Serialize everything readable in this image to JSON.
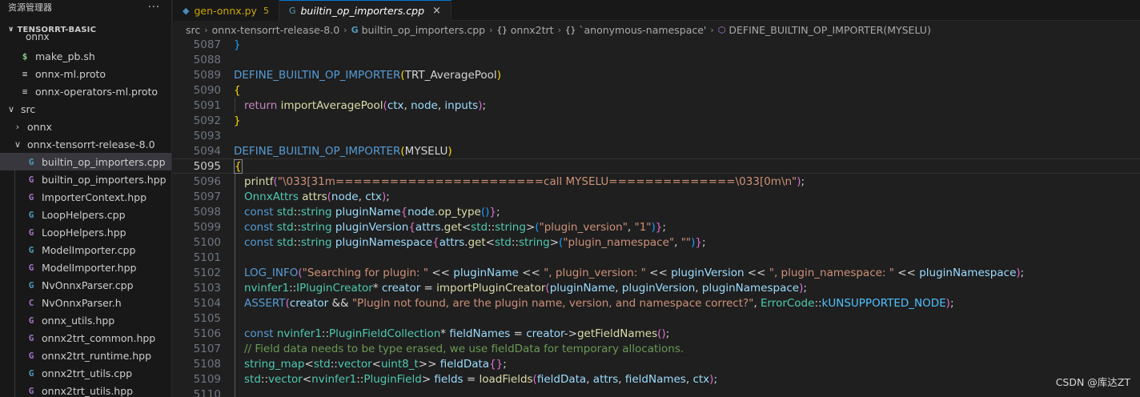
{
  "sidebar": {
    "title": "资源管理器",
    "more_label": "···",
    "section": "TENSORRT-BASIC",
    "cut_row": "onnx",
    "items": [
      {
        "name": "make_pb.sh",
        "icon": "shell-icon",
        "glyph": "$",
        "type": "shell",
        "depth": 1
      },
      {
        "name": "onnx-ml.proto",
        "icon": "lines-icon",
        "glyph": "≡",
        "type": "lines",
        "depth": 1
      },
      {
        "name": "onnx-operators-ml.proto",
        "icon": "lines-icon",
        "glyph": "≡",
        "type": "lines",
        "depth": 1
      },
      {
        "name": "src",
        "icon": "chevron-down-icon",
        "glyph": "∨",
        "type": "folder",
        "depth": 0
      },
      {
        "name": "onnx",
        "icon": "chevron-right-icon",
        "glyph": "›",
        "type": "folder",
        "depth": 1
      },
      {
        "name": "onnx-tensorrt-release-8.0",
        "icon": "chevron-down-icon",
        "glyph": "∨",
        "type": "folder",
        "depth": 1
      },
      {
        "name": "builtin_op_importers.cpp",
        "icon": "cpp-file-icon",
        "glyph": "G",
        "type": "cpp",
        "depth": 2,
        "selected": true
      },
      {
        "name": "builtin_op_importers.hpp",
        "icon": "hpp-file-icon",
        "glyph": "G",
        "type": "hpp",
        "depth": 2
      },
      {
        "name": "ImporterContext.hpp",
        "icon": "hpp-file-icon",
        "glyph": "G",
        "type": "hpp",
        "depth": 2
      },
      {
        "name": "LoopHelpers.cpp",
        "icon": "cpp-file-icon",
        "glyph": "G",
        "type": "cpp",
        "depth": 2
      },
      {
        "name": "LoopHelpers.hpp",
        "icon": "hpp-file-icon",
        "glyph": "G",
        "type": "hpp",
        "depth": 2
      },
      {
        "name": "ModelImporter.cpp",
        "icon": "cpp-file-icon",
        "glyph": "G",
        "type": "cpp",
        "depth": 2
      },
      {
        "name": "ModelImporter.hpp",
        "icon": "hpp-file-icon",
        "glyph": "G",
        "type": "hpp",
        "depth": 2
      },
      {
        "name": "NvOnnxParser.cpp",
        "icon": "cpp-file-icon",
        "glyph": "G",
        "type": "cpp",
        "depth": 2
      },
      {
        "name": "NvOnnxParser.h",
        "icon": "h-file-icon",
        "glyph": "C",
        "type": "h",
        "depth": 2
      },
      {
        "name": "onnx_utils.hpp",
        "icon": "hpp-file-icon",
        "glyph": "G",
        "type": "hpp",
        "depth": 2
      },
      {
        "name": "onnx2trt_common.hpp",
        "icon": "hpp-file-icon",
        "glyph": "G",
        "type": "hpp",
        "depth": 2
      },
      {
        "name": "onnx2trt_runtime.hpp",
        "icon": "hpp-file-icon",
        "glyph": "G",
        "type": "hpp",
        "depth": 2
      },
      {
        "name": "onnx2trt_utils.cpp",
        "icon": "cpp-file-icon",
        "glyph": "G",
        "type": "cpp",
        "depth": 2
      },
      {
        "name": "onnx2trt_utils.hpp",
        "icon": "hpp-file-icon",
        "glyph": "G",
        "type": "hpp",
        "depth": 2
      }
    ]
  },
  "tabs": [
    {
      "label": "gen-onnx.py",
      "badge": "5",
      "active": false,
      "icon_glyph": "◆"
    },
    {
      "label": "builtin_op_importers.cpp",
      "active": true,
      "icon_glyph": "G",
      "close": "×"
    }
  ],
  "breadcrumb": {
    "parts": [
      "src",
      "onnx-tensorrt-release-8.0",
      "builtin_op_importers.cpp",
      "onnx2trt",
      "`anonymous-namespace'",
      "DEFINE_BUILTIN_OP_IMPORTER(MYSELU)"
    ],
    "ns_glyph": "{}",
    "sep": "›"
  },
  "editor": {
    "lines": [
      {
        "n": "5087",
        "tokens": [
          [
            "k-brace3",
            "}"
          ]
        ]
      },
      {
        "n": "5088",
        "tokens": []
      },
      {
        "n": "5089",
        "tokens": [
          [
            "k-macro",
            "DEFINE_BUILTIN_OP_IMPORTER"
          ],
          [
            "k-brace1",
            "("
          ],
          [
            "k-plain",
            "TRT_AveragePool"
          ],
          [
            "k-brace1",
            ")"
          ]
        ]
      },
      {
        "n": "5090",
        "tokens": [
          [
            "k-brace1",
            "{"
          ]
        ]
      },
      {
        "n": "5091",
        "indent": 1,
        "tokens": [
          [
            "k-ctrl",
            "return "
          ],
          [
            "k-fn",
            "importAveragePool"
          ],
          [
            "k-brace2",
            "("
          ],
          [
            "k-var",
            "ctx"
          ],
          [
            "k-plain",
            ", "
          ],
          [
            "k-var",
            "node"
          ],
          [
            "k-plain",
            ", "
          ],
          [
            "k-var",
            "inputs"
          ],
          [
            "k-brace2",
            ")"
          ],
          [
            "k-plain",
            ";"
          ]
        ]
      },
      {
        "n": "5092",
        "tokens": [
          [
            "k-brace1",
            "}"
          ]
        ]
      },
      {
        "n": "5093",
        "tokens": []
      },
      {
        "n": "5094",
        "tokens": [
          [
            "k-macro",
            "DEFINE_BUILTIN_OP_IMPORTER"
          ],
          [
            "k-brace1",
            "("
          ],
          [
            "k-plain",
            "MYSELU"
          ],
          [
            "k-brace1",
            ")"
          ]
        ]
      },
      {
        "n": "5095",
        "current": true,
        "tokens": [
          [
            "k-brace1",
            "{"
          ]
        ]
      },
      {
        "n": "5096",
        "indent": 1,
        "tokens": [
          [
            "k-fn",
            "printf"
          ],
          [
            "k-brace2",
            "("
          ],
          [
            "k-str",
            "\"\\033[31m=======================call MYSELU==============\\033[0m\\n\""
          ],
          [
            "k-brace2",
            ")"
          ],
          [
            "k-plain",
            ";"
          ]
        ]
      },
      {
        "n": "5097",
        "indent": 1,
        "tokens": [
          [
            "k-type",
            "OnnxAttrs "
          ],
          [
            "k-fn",
            "attrs"
          ],
          [
            "k-brace2",
            "("
          ],
          [
            "k-var",
            "node"
          ],
          [
            "k-plain",
            ", "
          ],
          [
            "k-var",
            "ctx"
          ],
          [
            "k-brace2",
            ")"
          ],
          [
            "k-plain",
            ";"
          ]
        ]
      },
      {
        "n": "5098",
        "indent": 1,
        "tokens": [
          [
            "k-kw",
            "const "
          ],
          [
            "k-ns",
            "std"
          ],
          [
            "k-plain",
            "::"
          ],
          [
            "k-type",
            "string "
          ],
          [
            "k-var",
            "pluginName"
          ],
          [
            "k-brace2",
            "{"
          ],
          [
            "k-var",
            "node"
          ],
          [
            "k-plain",
            "."
          ],
          [
            "k-fn",
            "op_type"
          ],
          [
            "k-brace3",
            "()"
          ],
          [
            "k-brace2",
            "}"
          ],
          [
            "k-plain",
            ";"
          ]
        ]
      },
      {
        "n": "5099",
        "indent": 1,
        "tokens": [
          [
            "k-kw",
            "const "
          ],
          [
            "k-ns",
            "std"
          ],
          [
            "k-plain",
            "::"
          ],
          [
            "k-type",
            "string "
          ],
          [
            "k-var",
            "pluginVersion"
          ],
          [
            "k-brace2",
            "{"
          ],
          [
            "k-var",
            "attrs"
          ],
          [
            "k-plain",
            "."
          ],
          [
            "k-fn",
            "get"
          ],
          [
            "k-plain",
            "<"
          ],
          [
            "k-ns",
            "std"
          ],
          [
            "k-plain",
            "::"
          ],
          [
            "k-type",
            "string"
          ],
          [
            "k-plain",
            ">"
          ],
          [
            "k-brace3",
            "("
          ],
          [
            "k-str",
            "\"plugin_version\""
          ],
          [
            "k-plain",
            ", "
          ],
          [
            "k-str",
            "\"1\""
          ],
          [
            "k-brace3",
            ")"
          ],
          [
            "k-brace2",
            "}"
          ],
          [
            "k-plain",
            ";"
          ]
        ]
      },
      {
        "n": "5100",
        "indent": 1,
        "tokens": [
          [
            "k-kw",
            "const "
          ],
          [
            "k-ns",
            "std"
          ],
          [
            "k-plain",
            "::"
          ],
          [
            "k-type",
            "string "
          ],
          [
            "k-var",
            "pluginNamespace"
          ],
          [
            "k-brace2",
            "{"
          ],
          [
            "k-var",
            "attrs"
          ],
          [
            "k-plain",
            "."
          ],
          [
            "k-fn",
            "get"
          ],
          [
            "k-plain",
            "<"
          ],
          [
            "k-ns",
            "std"
          ],
          [
            "k-plain",
            "::"
          ],
          [
            "k-type",
            "string"
          ],
          [
            "k-plain",
            ">"
          ],
          [
            "k-brace3",
            "("
          ],
          [
            "k-str",
            "\"plugin_namespace\""
          ],
          [
            "k-plain",
            ", "
          ],
          [
            "k-str",
            "\"\""
          ],
          [
            "k-brace3",
            ")"
          ],
          [
            "k-brace2",
            "}"
          ],
          [
            "k-plain",
            ";"
          ]
        ]
      },
      {
        "n": "5101",
        "tokens": []
      },
      {
        "n": "5102",
        "indent": 1,
        "tokens": [
          [
            "k-macro",
            "LOG_INFO"
          ],
          [
            "k-brace2",
            "("
          ],
          [
            "k-str",
            "\"Searching for plugin: \""
          ],
          [
            "k-plain",
            " << "
          ],
          [
            "k-var",
            "pluginName"
          ],
          [
            "k-plain",
            " << "
          ],
          [
            "k-str",
            "\", plugin_version: \""
          ],
          [
            "k-plain",
            " << "
          ],
          [
            "k-var",
            "pluginVersion"
          ],
          [
            "k-plain",
            " << "
          ],
          [
            "k-str",
            "\", plugin_namespace: \""
          ],
          [
            "k-plain",
            " << "
          ],
          [
            "k-var",
            "pluginNamespace"
          ],
          [
            "k-brace2",
            ")"
          ],
          [
            "k-plain",
            ";"
          ]
        ]
      },
      {
        "n": "5103",
        "indent": 1,
        "tokens": [
          [
            "k-ns",
            "nvinfer1"
          ],
          [
            "k-plain",
            "::"
          ],
          [
            "k-type",
            "IPluginCreator"
          ],
          [
            "k-plain",
            "* "
          ],
          [
            "k-var",
            "creator"
          ],
          [
            "k-plain",
            " = "
          ],
          [
            "k-fn",
            "importPluginCreator"
          ],
          [
            "k-brace2",
            "("
          ],
          [
            "k-var",
            "pluginName"
          ],
          [
            "k-plain",
            ", "
          ],
          [
            "k-var",
            "pluginVersion"
          ],
          [
            "k-plain",
            ", "
          ],
          [
            "k-var",
            "pluginNamespace"
          ],
          [
            "k-brace2",
            ")"
          ],
          [
            "k-plain",
            ";"
          ]
        ]
      },
      {
        "n": "5104",
        "indent": 1,
        "tokens": [
          [
            "k-macro",
            "ASSERT"
          ],
          [
            "k-brace2",
            "("
          ],
          [
            "k-var",
            "creator"
          ],
          [
            "k-plain",
            " && "
          ],
          [
            "k-str",
            "\"Plugin not found, are the plugin name, version, and namespace correct?\""
          ],
          [
            "k-plain",
            ", "
          ],
          [
            "k-type",
            "ErrorCode"
          ],
          [
            "k-plain",
            "::"
          ],
          [
            "k-enum",
            "kUNSUPPORTED_NODE"
          ],
          [
            "k-brace2",
            ")"
          ],
          [
            "k-plain",
            ";"
          ]
        ]
      },
      {
        "n": "5105",
        "tokens": []
      },
      {
        "n": "5106",
        "indent": 1,
        "tokens": [
          [
            "k-kw",
            "const "
          ],
          [
            "k-ns",
            "nvinfer1"
          ],
          [
            "k-plain",
            "::"
          ],
          [
            "k-type",
            "PluginFieldCollection"
          ],
          [
            "k-plain",
            "* "
          ],
          [
            "k-var",
            "fieldNames"
          ],
          [
            "k-plain",
            " = "
          ],
          [
            "k-var",
            "creator"
          ],
          [
            "k-plain",
            "->"
          ],
          [
            "k-fn",
            "getFieldNames"
          ],
          [
            "k-brace2",
            "()"
          ],
          [
            "k-plain",
            ";"
          ]
        ]
      },
      {
        "n": "5107",
        "indent": 1,
        "tokens": [
          [
            "k-com",
            "// Field data needs to be type erased, we use fieldData for temporary allocations."
          ]
        ]
      },
      {
        "n": "5108",
        "indent": 1,
        "tokens": [
          [
            "k-type",
            "string_map"
          ],
          [
            "k-plain",
            "<"
          ],
          [
            "k-ns",
            "std"
          ],
          [
            "k-plain",
            "::"
          ],
          [
            "k-type",
            "vector"
          ],
          [
            "k-plain",
            "<"
          ],
          [
            "k-type",
            "uint8_t"
          ],
          [
            "k-plain",
            ">> "
          ],
          [
            "k-var",
            "fieldData"
          ],
          [
            "k-brace2",
            "{}"
          ],
          [
            "k-plain",
            ";"
          ]
        ]
      },
      {
        "n": "5109",
        "indent": 1,
        "tokens": [
          [
            "k-ns",
            "std"
          ],
          [
            "k-plain",
            "::"
          ],
          [
            "k-type",
            "vector"
          ],
          [
            "k-plain",
            "<"
          ],
          [
            "k-ns",
            "nvinfer1"
          ],
          [
            "k-plain",
            "::"
          ],
          [
            "k-type",
            "PluginField"
          ],
          [
            "k-plain",
            "> "
          ],
          [
            "k-var",
            "fields"
          ],
          [
            "k-plain",
            " = "
          ],
          [
            "k-fn",
            "loadFields"
          ],
          [
            "k-brace2",
            "("
          ],
          [
            "k-var",
            "fieldData"
          ],
          [
            "k-plain",
            ", "
          ],
          [
            "k-var",
            "attrs"
          ],
          [
            "k-plain",
            ", "
          ],
          [
            "k-var",
            "fieldNames"
          ],
          [
            "k-plain",
            ", "
          ],
          [
            "k-var",
            "ctx"
          ],
          [
            "k-brace2",
            ")"
          ],
          [
            "k-plain",
            ";"
          ]
        ]
      },
      {
        "n": "5110",
        "tokens": []
      }
    ]
  },
  "watermark": "CSDN @库达ZT"
}
